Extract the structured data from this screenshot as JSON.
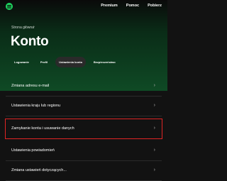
{
  "topnav": {
    "items": [
      "Premium",
      "Pomoc",
      "Pobierz"
    ]
  },
  "breadcrumb": "Strona główna",
  "breadcrumb_sep": "›",
  "page_title": "Konto",
  "tabs": [
    {
      "label": "Logowanie",
      "active": false
    },
    {
      "label": "Profil",
      "active": false
    },
    {
      "label": "Ustawienia konta",
      "active": true
    },
    {
      "label": "Bezpieczeństwo",
      "active": false
    }
  ],
  "settings": [
    {
      "label": "Zmiana adresu e-mail"
    },
    {
      "label": "Ustawienia kraju lub regionu"
    },
    {
      "label": "Zamykanie konta i usuwanie danych",
      "highlighted": true
    },
    {
      "label": "Ustawienia powiadomień"
    },
    {
      "label": "Zmiana ustawień dotyczących..."
    }
  ],
  "colors": {
    "accent": "#1ed760",
    "highlight": "#e02424",
    "background": "#121212"
  },
  "icons": {
    "chevron": "chevron-right-icon",
    "logo": "spotify-logo"
  }
}
